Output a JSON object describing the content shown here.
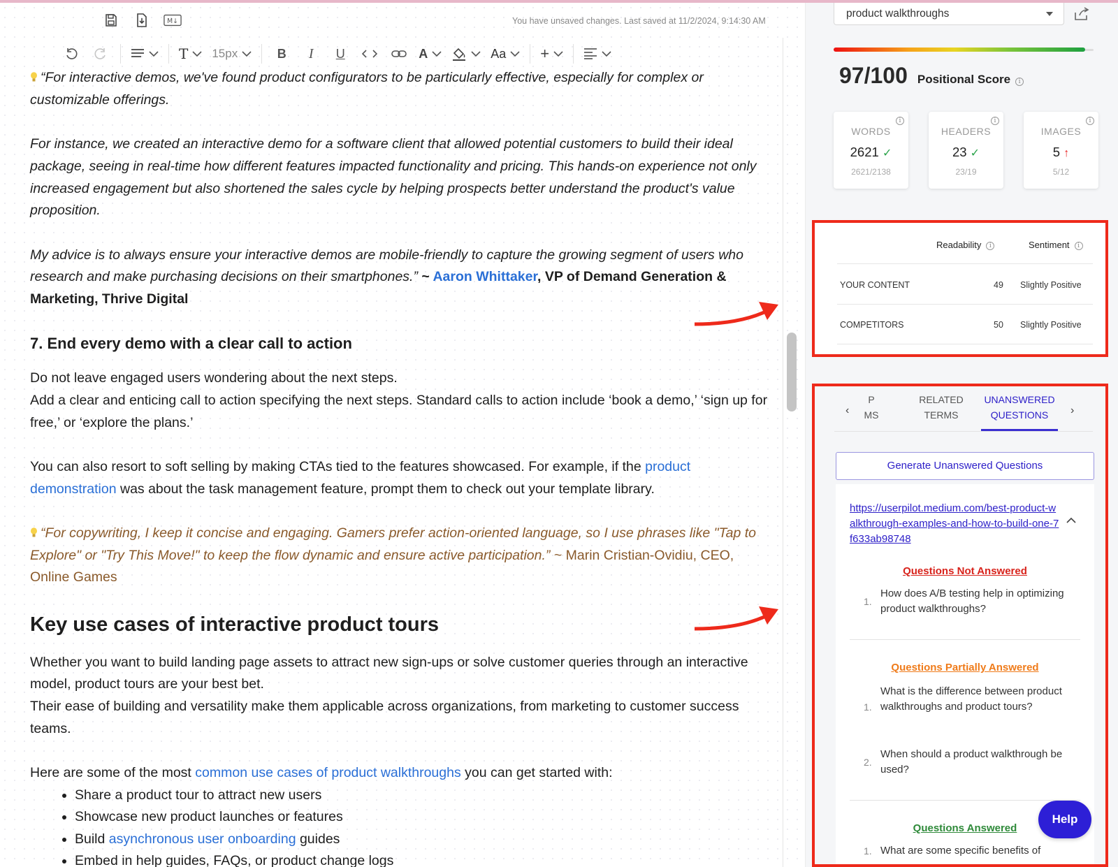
{
  "editor": {
    "save_status": "You have unsaved changes. Last saved at 11/2/2024, 9:14:30 AM",
    "font_size": "15px",
    "toolbar_icons": [
      "save-icon",
      "download-icon",
      "markdown-icon",
      "undo-icon",
      "redo-icon",
      "paragraph-icon",
      "text-style-icon",
      "bold-icon",
      "italic-icon",
      "underline-icon",
      "code-icon",
      "link-icon",
      "font-color-icon",
      "highlight-icon",
      "text-case-icon",
      "insert-icon",
      "align-icon"
    ],
    "markdown_label": "M↓",
    "bold_label": "B",
    "italic_label": "I",
    "underline_label": "U",
    "case_label": "Aa",
    "text_label": "T",
    "font_color_label": "A",
    "insert_label": "+",
    "p1": "“For interactive demos, we've found product configurators to be particularly effective, especially for complex or customizable offerings.",
    "p2": "For instance, we created an interactive demo for a software client that allowed potential customers to build their ideal package, seeing in real-time how different features impacted functionality and pricing. This hands-on experience not only increased engagement but also shortened the sales cycle by helping prospects better understand the product's value proposition.",
    "p3_text": "My advice is to always ensure your interactive demos are mobile-friendly to capture the growing segment of users who research and make purchasing decisions on their smartphones.”",
    "p3_tilde": " ~ ",
    "p3_name": "Aaron Whittaker",
    "p3_role": ", VP of Demand Generation & Marketing, Thrive Digital",
    "h3": "7. End every demo with a clear call to action",
    "p4_line1": "Do not leave engaged users wondering about the next steps.",
    "p4_line2": "Add a clear and enticing call to action specifying the next steps. Standard calls to action include ‘book a demo,’ ‘sign up for free,’ or ‘explore the plans.’",
    "p5_a": "You can also resort to soft selling by making CTAs tied to the features showcased. For example, if the ",
    "p5_link": "product demonstration",
    "p5_b": " was about the task management feature, prompt them to check out your template library.",
    "q2_quote": "“For copywriting, I keep it concise and engaging. Gamers prefer action-oriented language, so I use phrases like \"Tap to Explore\" or \"Try This Move!\" to keep the flow dynamic and ensure active participation.”",
    "q2_attrib": " ~ Marin Cristian-Ovidiu, CEO, Online Games",
    "h2": "Key use cases of interactive product tours",
    "p6_line1": "Whether you want to build landing page assets to attract new sign-ups or solve customer queries through an interactive model, product tours are your best bet.",
    "p6_line2": "Their ease of building and versatility make them applicable across organizations, from marketing to customer success teams.",
    "p7_a": "Here are some of the most ",
    "p7_link": "common use cases of product walkthroughs",
    "p7_b": " you can get started with:",
    "bullets": [
      {
        "a": "Share a product tour to attract new users",
        "link": "",
        "b": ""
      },
      {
        "a": "Showcase new product launches or features",
        "link": "",
        "b": ""
      },
      {
        "a": "Build ",
        "link": "asynchronous user onboarding",
        "b": " guides"
      },
      {
        "a": "Embed in help guides, FAQs, or product change logs",
        "link": "",
        "b": ""
      }
    ]
  },
  "panel": {
    "keyword": "product walkthroughs",
    "score": "97/100",
    "score_label": "Positional Score",
    "info_glyph": "i",
    "stats": [
      {
        "label": "WORDS",
        "value": "2621",
        "sub": "2621/2138",
        "status": "ok"
      },
      {
        "label": "HEADERS",
        "value": "23",
        "sub": "23/19",
        "status": "ok"
      },
      {
        "label": "IMAGES",
        "value": "5",
        "sub": "5/12",
        "status": "up"
      }
    ],
    "readability": {
      "col1": "Readability",
      "col2": "Sentiment",
      "rows": [
        {
          "label": "YOUR CONTENT",
          "score": "49",
          "sentiment": "Slightly Positive"
        },
        {
          "label": "COMPETITORS",
          "score": "50",
          "sentiment": "Slightly Positive"
        }
      ]
    },
    "tabs": {
      "partial_line1": "P",
      "partial_line2": "MS",
      "related_line1": "RELATED",
      "related_line2": "TERMS",
      "active_line1": "UNANSWERED",
      "active_line2": "QUESTIONS"
    },
    "generate_label": "Generate Unanswered Questions",
    "url": "https://userpilot.medium.com/best-product-walkthrough-examples-and-how-to-build-one-7f633ab98748",
    "sections": {
      "not_answered": {
        "title": "Questions Not Answered",
        "items": [
          "How does A/B testing help in optimizing product walkthroughs?"
        ]
      },
      "partial": {
        "title": "Questions Partially Answered",
        "items": [
          "What is the difference between product walkthroughs and product tours?",
          "When should a product walkthrough be used?"
        ]
      },
      "answered": {
        "title": "Questions Answered",
        "items": [
          "What are some specific benefits of"
        ]
      }
    },
    "numbers": [
      "1.",
      "2."
    ],
    "help_label": "Help"
  },
  "colors": {
    "annotation_red": "#ee2a1b",
    "accent": "#2c1ec8",
    "not_answered": "#d8231c",
    "partial": "#ef7b1a",
    "answered": "#2f8a3a"
  }
}
